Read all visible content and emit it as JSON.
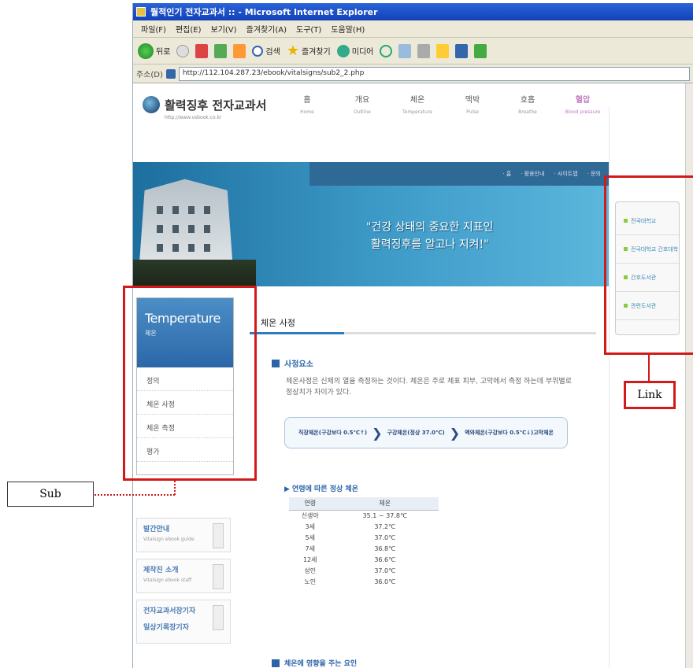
{
  "window": {
    "title": "뭘적인기 전자교과서 :: - Microsoft Internet Explorer"
  },
  "menubar": {
    "items": [
      "파일(F)",
      "편집(E)",
      "보기(V)",
      "즐겨찾기(A)",
      "도구(T)",
      "도움말(H)"
    ]
  },
  "toolbar": {
    "back_label": "뒤로",
    "search_label": "검색",
    "favorites_label": "즐겨찾기",
    "media_label": "미디어"
  },
  "address": {
    "label": "주소(D)",
    "url": "http://112.104.287.23/ebook/vitalsigns/sub2_2.php"
  },
  "site": {
    "logo_text": "활력징후 전자교과서",
    "logo_sub": "http://www.vsbook.co.kr",
    "nav": [
      {
        "ko": "홈",
        "en": "Home",
        "active": false
      },
      {
        "ko": "개요",
        "en": "Outline",
        "active": false
      },
      {
        "ko": "체온",
        "en": "Temperature",
        "active": false
      },
      {
        "ko": "맥박",
        "en": "Pulse",
        "active": false
      },
      {
        "ko": "호흡",
        "en": "Breathe",
        "active": false
      },
      {
        "ko": "혈압",
        "en": "Blood pressure",
        "active": true
      }
    ],
    "banner": {
      "top_links": [
        "· 홈",
        "· 활용안내",
        "· 사이트맵",
        "· 문의"
      ],
      "quote_line1": "\"건강 상태의 중요한 지표인",
      "quote_line2": "활력징후를 알고나 지켜!\""
    }
  },
  "submenu": {
    "title_en": "Temperature",
    "title_ko": "체온",
    "items": [
      "정의",
      "체온 사정",
      "체온 측정",
      "평가"
    ]
  },
  "promos": [
    {
      "title": "발간안내",
      "sub": "Vitalsign ebook guide"
    },
    {
      "title": "제작진 소개",
      "sub": "Vitalsign ebook staff"
    },
    {
      "title": "전자교과서장기자",
      "sub": "일상기록장기자"
    }
  ],
  "content": {
    "tab_label": "체온 사정",
    "section_title": "사정요소",
    "paragraph": "체온사정은 신체의 열을 측정하는 것이다. 체온은 주로 체표 피부, 고막에서 측정 하는데 부위별로 정상치가 차이가 있다.",
    "flow": [
      "직장체온(구강보다 0.5℃↑)",
      "구강체온(정상 37.0℃)",
      "액와체온(구강보다 0.5℃↓)고막체온"
    ],
    "sub_heading": "▶ 연령에 따른 정상 체온",
    "table": {
      "headers": [
        "연령",
        "체온"
      ],
      "rows": [
        [
          "신생아",
          "35.1 ~ 37.8℃"
        ],
        [
          "3세",
          "37.2℃"
        ],
        [
          "5세",
          "37.0℃"
        ],
        [
          "7세",
          "36.8℃"
        ],
        [
          "12세",
          "36.6℃"
        ],
        [
          "성인",
          "37.0℃"
        ],
        [
          "노인",
          "36.0℃"
        ]
      ]
    },
    "section2_title": "체온에 영향을 주는 요인"
  },
  "links": {
    "items": [
      "전국대학교",
      "전국대학교 간호대학",
      "간호도서관",
      "관련도서관"
    ]
  },
  "annotations": {
    "sub_label": "Sub",
    "link_label": "Link"
  },
  "colors": {
    "annotation_red": "#d21a1a",
    "nav_active": "#c37ac4",
    "section_blue": "#2b65a8"
  }
}
